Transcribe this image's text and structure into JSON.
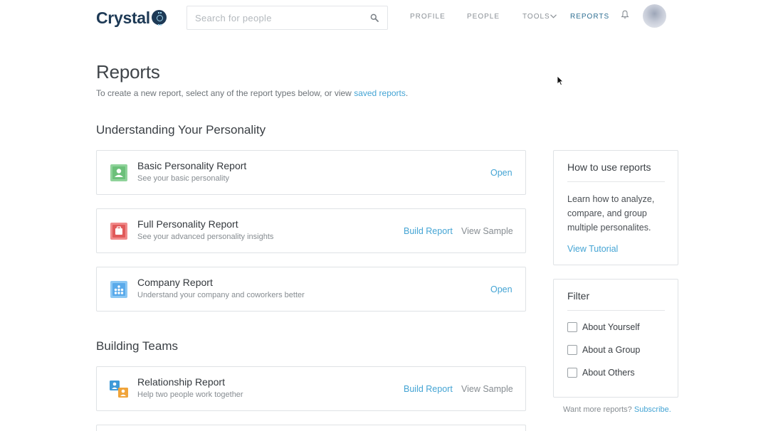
{
  "header": {
    "logo_text": "Crystal",
    "search_placeholder": "Search for people",
    "nav": {
      "profile": "PROFILE",
      "people": "PEOPLE",
      "tools": "TOOLS",
      "reports": "REPORTS"
    }
  },
  "page": {
    "title": "Reports",
    "subtitle_prefix": "To create a new report, select any of the report types below, or view ",
    "subtitle_link": "saved reports",
    "subtitle_suffix": "."
  },
  "sections": {
    "personality": {
      "title": "Understanding Your Personality",
      "cards": [
        {
          "title": "Basic Personality Report",
          "desc": "See your basic personality",
          "primary": "Open",
          "icon": "person-card-icon",
          "color": "#6cc07a"
        },
        {
          "title": "Full Personality Report",
          "desc": "See your advanced personality insights",
          "primary": "Build Report",
          "secondary": "View Sample",
          "icon": "briefcase-icon",
          "color": "#e05a5a"
        },
        {
          "title": "Company Report",
          "desc": "Understand your company and coworkers better",
          "primary": "Open",
          "icon": "org-chart-icon",
          "color": "#5aaaea"
        }
      ]
    },
    "teams": {
      "title": "Building Teams",
      "cards": [
        {
          "title": "Relationship Report",
          "desc": "Help two people work together",
          "primary": "Build Report",
          "secondary": "View Sample",
          "icon": "two-people-icon",
          "color": "#3f9ad8"
        }
      ]
    }
  },
  "sidebar": {
    "howto": {
      "title": "How to use reports",
      "text": "Learn how to analyze, compare, and group multiple personalites.",
      "link": "View Tutorial"
    },
    "filter": {
      "title": "Filter",
      "options": [
        "About Yourself",
        "About a Group",
        "About Others"
      ]
    },
    "footnote_prefix": "Want more reports? ",
    "footnote_link": "Subscribe."
  },
  "colors": {
    "accent": "#44a4d4",
    "brand": "#1e3a56",
    "nav_active": "#2f6f93"
  }
}
